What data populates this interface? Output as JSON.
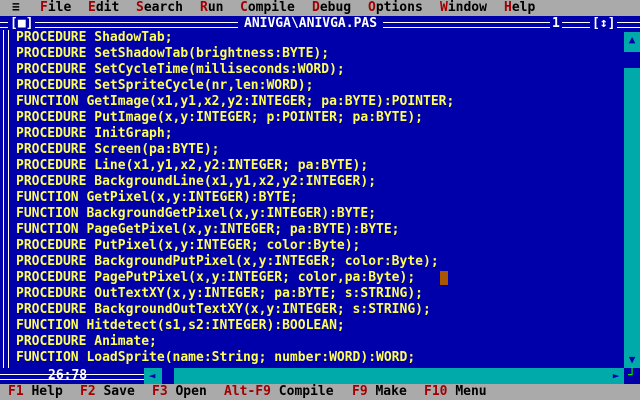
{
  "menu": {
    "system": "≡",
    "items": [
      {
        "hot": "F",
        "rest": "ile"
      },
      {
        "hot": "E",
        "rest": "dit"
      },
      {
        "hot": "S",
        "rest": "earch"
      },
      {
        "hot": "R",
        "rest": "un"
      },
      {
        "hot": "C",
        "rest": "ompile"
      },
      {
        "hot": "D",
        "rest": "ebug"
      },
      {
        "hot": "O",
        "rest": "ptions"
      },
      {
        "hot": "W",
        "rest": "indow"
      },
      {
        "hot": "H",
        "rest": "elp"
      }
    ]
  },
  "window": {
    "close_box": "[■]",
    "title": "ANIVGA\\ANIVGA.PAS",
    "number": "1",
    "zoom_box": "[↕]"
  },
  "code_lines": [
    "PROCEDURE ShadowTab;",
    "PROCEDURE SetShadowTab(brightness:BYTE);",
    "PROCEDURE SetCycleTime(milliseconds:WORD);",
    "PROCEDURE SetSpriteCycle(nr,len:WORD);",
    "FUNCTION GetImage(x1,y1,x2,y2:INTEGER; pa:BYTE):POINTER;",
    "PROCEDURE PutImage(x,y:INTEGER; p:POINTER; pa:BYTE);",
    "PROCEDURE InitGraph;",
    "PROCEDURE Screen(pa:BYTE);",
    "PROCEDURE Line(x1,y1,x2,y2:INTEGER; pa:BYTE);",
    "PROCEDURE BackgroundLine(x1,y1,x2,y2:INTEGER);",
    "FUNCTION GetPixel(x,y:INTEGER):BYTE;",
    "FUNCTION BackgroundGetPixel(x,y:INTEGER):BYTE;",
    "FUNCTION PageGetPixel(x,y:INTEGER; pa:BYTE):BYTE;",
    "PROCEDURE PutPixel(x,y:INTEGER; color:Byte);",
    "PROCEDURE BackgroundPutPixel(x,y:INTEGER; color:Byte);",
    "PROCEDURE PagePutPixel(x,y:INTEGER; color,pa:Byte);",
    "PROCEDURE OutTextXY(x,y:INTEGER; pa:BYTE; s:STRING);",
    "PROCEDURE BackgroundOutTextXY(x,y:INTEGER; s:STRING);",
    "FUNCTION Hitdetect(s1,s2:INTEGER):BOOLEAN;",
    "PROCEDURE Animate;",
    "FUNCTION LoadSprite(name:String; number:WORD):WORD;"
  ],
  "cursor": {
    "line": 15,
    "column": 55
  },
  "status": {
    "position": "26:78"
  },
  "scroll": {
    "up": "▲",
    "down": "▼",
    "left": "◄",
    "right": "►",
    "corner": "┘"
  },
  "function_keys": [
    {
      "key": "F1",
      "label": "Help"
    },
    {
      "key": "F2",
      "label": "Save"
    },
    {
      "key": "F3",
      "label": "Open"
    },
    {
      "key": "Alt-F9",
      "label": "Compile"
    },
    {
      "key": "F9",
      "label": "Make"
    },
    {
      "key": "F10",
      "label": "Menu"
    }
  ],
  "colors": {
    "editor_bg": "#0000aa",
    "text": "#ffff55",
    "menu_bg": "#aaaaaa",
    "hotkey": "#a00000",
    "scrollbar": "#00aaaa",
    "accent_green": "#00ff00",
    "cursor": "#aa5500"
  }
}
